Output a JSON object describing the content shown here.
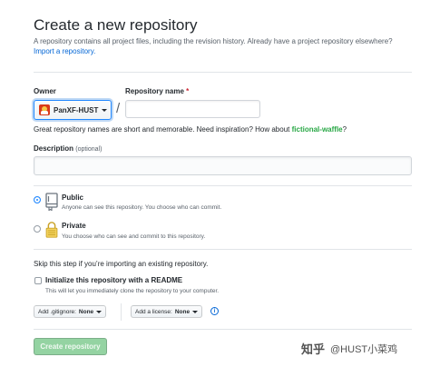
{
  "header": {
    "title": "Create a new repository",
    "subtitle": "A repository contains all project files, including the revision history. Already have a project repository elsewhere?",
    "import_link": "Import a repository."
  },
  "owner": {
    "label": "Owner",
    "value": "PanXF-HUST"
  },
  "repo_name": {
    "label": "Repository name",
    "required_mark": "*",
    "value": "",
    "separator": "/"
  },
  "hint": {
    "text": "Great repository names are short and memorable. Need inspiration? How about",
    "suggestion": "fictional-waffle",
    "end": "?"
  },
  "description": {
    "label": "Description",
    "optional": "(optional)",
    "value": ""
  },
  "visibility": {
    "selected": "public",
    "public": {
      "title": "Public",
      "desc": "Anyone can see this repository. You choose who can commit."
    },
    "private": {
      "title": "Private",
      "desc": "You choose who can see and commit to this repository."
    }
  },
  "init": {
    "skip_text": "Skip this step if you’re importing an existing repository.",
    "checkbox_label": "Initialize this repository with a README",
    "checkbox_desc": "This will let you immediately clone the repository to your computer.",
    "checked": false,
    "gitignore_prefix": "Add .gitignore:",
    "gitignore_value": "None",
    "license_prefix": "Add a license:",
    "license_value": "None",
    "info_icon": "i"
  },
  "submit": {
    "label": "Create repository"
  },
  "watermark": {
    "zh": "知乎",
    "handle": "@HUST小菜鸡"
  },
  "colors": {
    "link": "#0366d6",
    "suggestion": "#28a745",
    "required": "#cb2431",
    "create_button": "#94d3a2",
    "focus": "#2188ff"
  }
}
